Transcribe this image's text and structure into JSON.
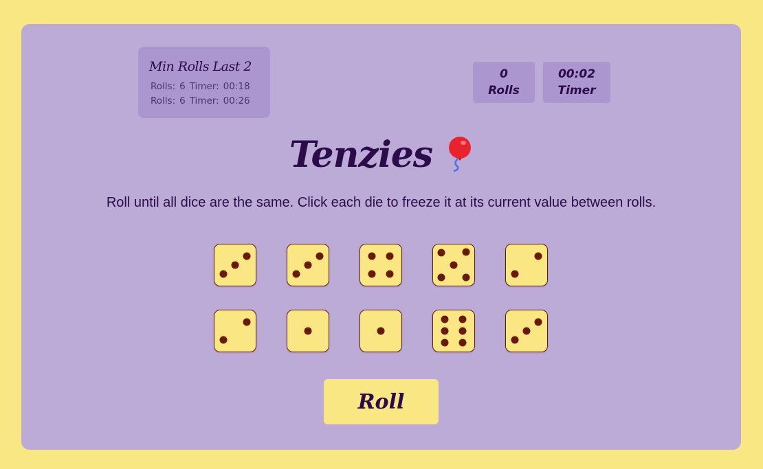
{
  "history": {
    "title": "Min Rolls Last 2",
    "entries": [
      {
        "rolls_label": "Rolls:",
        "rolls": "6",
        "timer_label": "Timer:",
        "timer": "00:18"
      },
      {
        "rolls_label": "Rolls:",
        "rolls": "6",
        "timer_label": "Timer:",
        "timer": "00:26"
      }
    ]
  },
  "stats": {
    "rolls_value": "0",
    "rolls_label": "Rolls",
    "timer_value": "00:02",
    "timer_label": "Timer"
  },
  "title": "Tenzies",
  "title_icon": "balloon-icon",
  "instructions": "Roll until all dice are the same. Click each die to freeze it at its current value between rolls.",
  "dice": [
    3,
    3,
    4,
    5,
    2,
    2,
    1,
    1,
    6,
    3
  ],
  "roll_button": "Roll",
  "colors": {
    "background": "#f9e784",
    "card": "#bdabd7",
    "panel": "#ac96cf",
    "die_face": "#fbe684",
    "pip": "#6b1a02",
    "text": "#2b0b4a"
  }
}
